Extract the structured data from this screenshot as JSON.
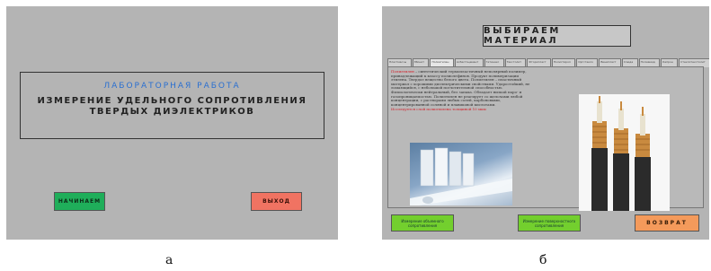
{
  "screen_a": {
    "subtitle": "ЛАБОРАТОРНАЯ РАБОТА",
    "title_line1": "ИЗМЕРЕНИЕ УДЕЛЬНОГО СОПРОТИВЛЕНИЯ",
    "title_line2": "ТВЕРДЫХ ДИЭЛЕКТРИКОВ",
    "start_button": "НАЧИНАЕМ",
    "exit_button": "ВЫХОД",
    "colors": {
      "background": "#b4b4b4",
      "subtitle": "#2a6fd0",
      "start": "#1fae5a",
      "exit": "#f07362"
    }
  },
  "screen_b": {
    "header": "ВЫБИРАЕМ МАТЕРИАЛ",
    "tabs": [
      "Пластмассы",
      "Эбонит",
      "Полиэтилен",
      "Асбестоцемент",
      "Гетинакс",
      "Текстолит",
      "Фторопласт",
      "Полистирол",
      "Оргстекло",
      "Винипласт",
      "Слюда",
      "Полиамид",
      "Капрон",
      "Стеклотекстолит"
    ],
    "active_tab_index": 2,
    "paragraph_term": "Полиэтилен",
    "paragraph": " – синтетический термопластичный неполярный полимер, принадлежащий к классу полиолефинов. Продукт полимеризации этилена. Твердое вещество белого цвета. Полиэтилен – пластичный материал с хорошими диэлектрическими свойствами. Ударостойкий, не ломающийся, с небольшой поглотительной способностью. Физиологически нейтральный, без запаха. Обладает низкой паро- и газопроницаемостью. Полиэтилен не реагирует со щелочами любой концентрации, с растворами любых солей, карбоновыми, концентрированной соляной и плавиковой кислотами.",
    "red_note": "Исследуется слой полиэтилена толщиной 10 мкм",
    "button1": "Измерение объемного сопротивления",
    "button2": "Измерение поверхностного сопротивления",
    "return_button": "ВОЗВРАТ",
    "colors": {
      "background": "#b4b4b4",
      "green_button": "#73cf2e",
      "orange_button": "#f49a5b",
      "term": "#d3212b"
    }
  },
  "captions": {
    "a": "а",
    "b": "б"
  }
}
